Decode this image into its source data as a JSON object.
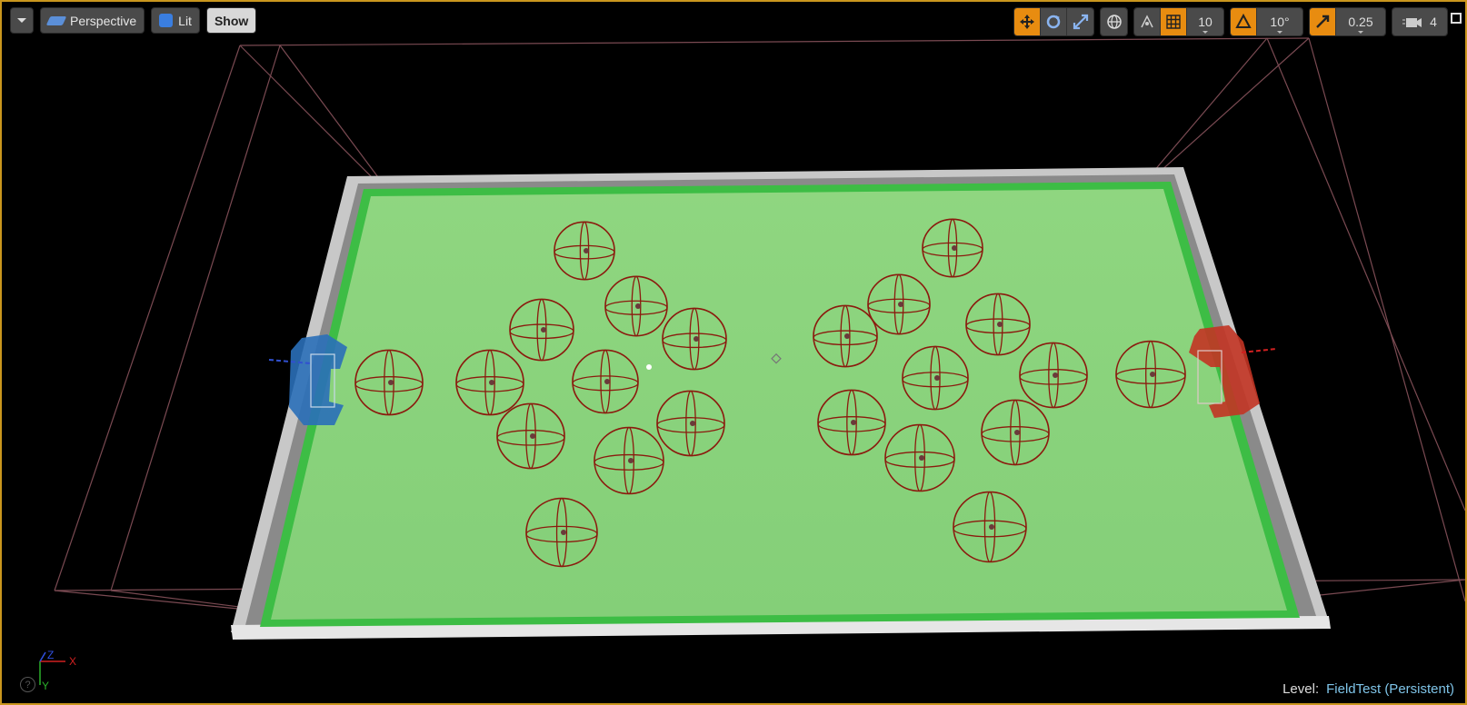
{
  "toolbar_left": {
    "menu_icon": "chevron-down-icon",
    "view_mode": "Perspective",
    "lighting_mode": "Lit",
    "show_label": "Show"
  },
  "toolbar_right": {
    "grid_snap": "10",
    "rotation_snap": "10°",
    "scale_snap": "0.25",
    "camera_speed": "4"
  },
  "status": {
    "level_label": "Level:",
    "level_name": "FieldTest (Persistent)"
  },
  "axis_labels": {
    "z": "Z",
    "x": "X",
    "y": "Y"
  },
  "colors": {
    "field": "#8ed47f",
    "field_edge": "#3dbd45",
    "wall": "#d8d8d8",
    "ball_wire": "#8b1a0e",
    "bounds_line": "#7a4a52",
    "goal_blue": "#2a6fb8",
    "goal_red": "#c23424",
    "accent": "#e88c10",
    "border": "#c9961d"
  }
}
